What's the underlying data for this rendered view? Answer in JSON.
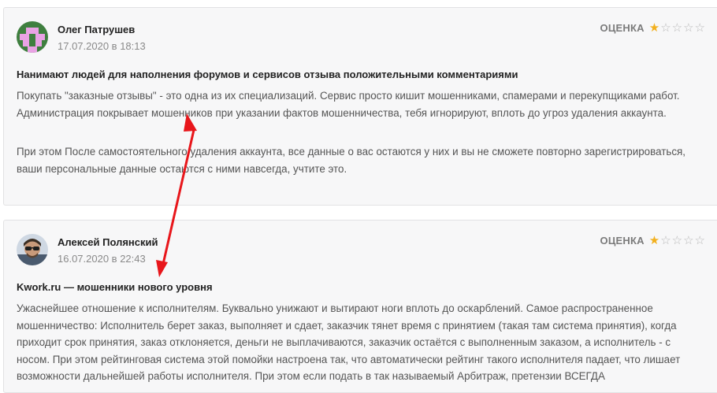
{
  "reviews": [
    {
      "author": "Олег Патрушев",
      "date": "17.07.2020 в 18:13",
      "rating_label": "ОЦЕНКА",
      "rating": 1,
      "rating_max": 5,
      "title": "Нанимают людей для наполнения форумов и сервисов отзыва положительными комментариями",
      "paragraphs": [
        "Покупать \"заказные отзывы\" - это одна из их специализаций. Сервис просто кишит мошенниками, спамерами и перекупщиками работ. Администрация покрывает мошенников при указании фактов мошенничества, тебя игнорируют, вплоть до угроз удаления аккаунта.",
        "При этом После самостоятельного удаления аккаунта, все данные о вас остаются у них и вы не сможете повторно зарегистрироваться, ваши персональные данные остаются с ними навсегда, учтите это."
      ]
    },
    {
      "author": "Алексей Полянский",
      "date": "16.07.2020 в 22:43",
      "rating_label": "ОЦЕНКА",
      "rating": 1,
      "rating_max": 5,
      "title": "Kwork.ru — мошенники нового уровня",
      "paragraphs": [
        "Ужаснейшее отношение к исполнителям. Буквально унижают и вытирают ноги вплоть до оскарблений. Самое распространенное мошенничество: Исполнитель берет заказ, выполняет и сдает, заказчик тянет время с принятием (такая там система принятия), когда приходит срок принятия, заказ отклоняется, деньги не выплачиваются, заказчик остаётся с выполненным заказом, а исполнитель - с носом. При этом рейтинговая система этой помойки настроена так, что автоматически рейтинг такого исполнителя падает, что лишает возможности дальнейшей работы исполнителя. При этом если подать в так называемый Арбитраж, претензии ВСЕГДА"
      ]
    }
  ],
  "annotation": {
    "color": "#e8161b",
    "icon": "arrow-annotation-icon"
  }
}
